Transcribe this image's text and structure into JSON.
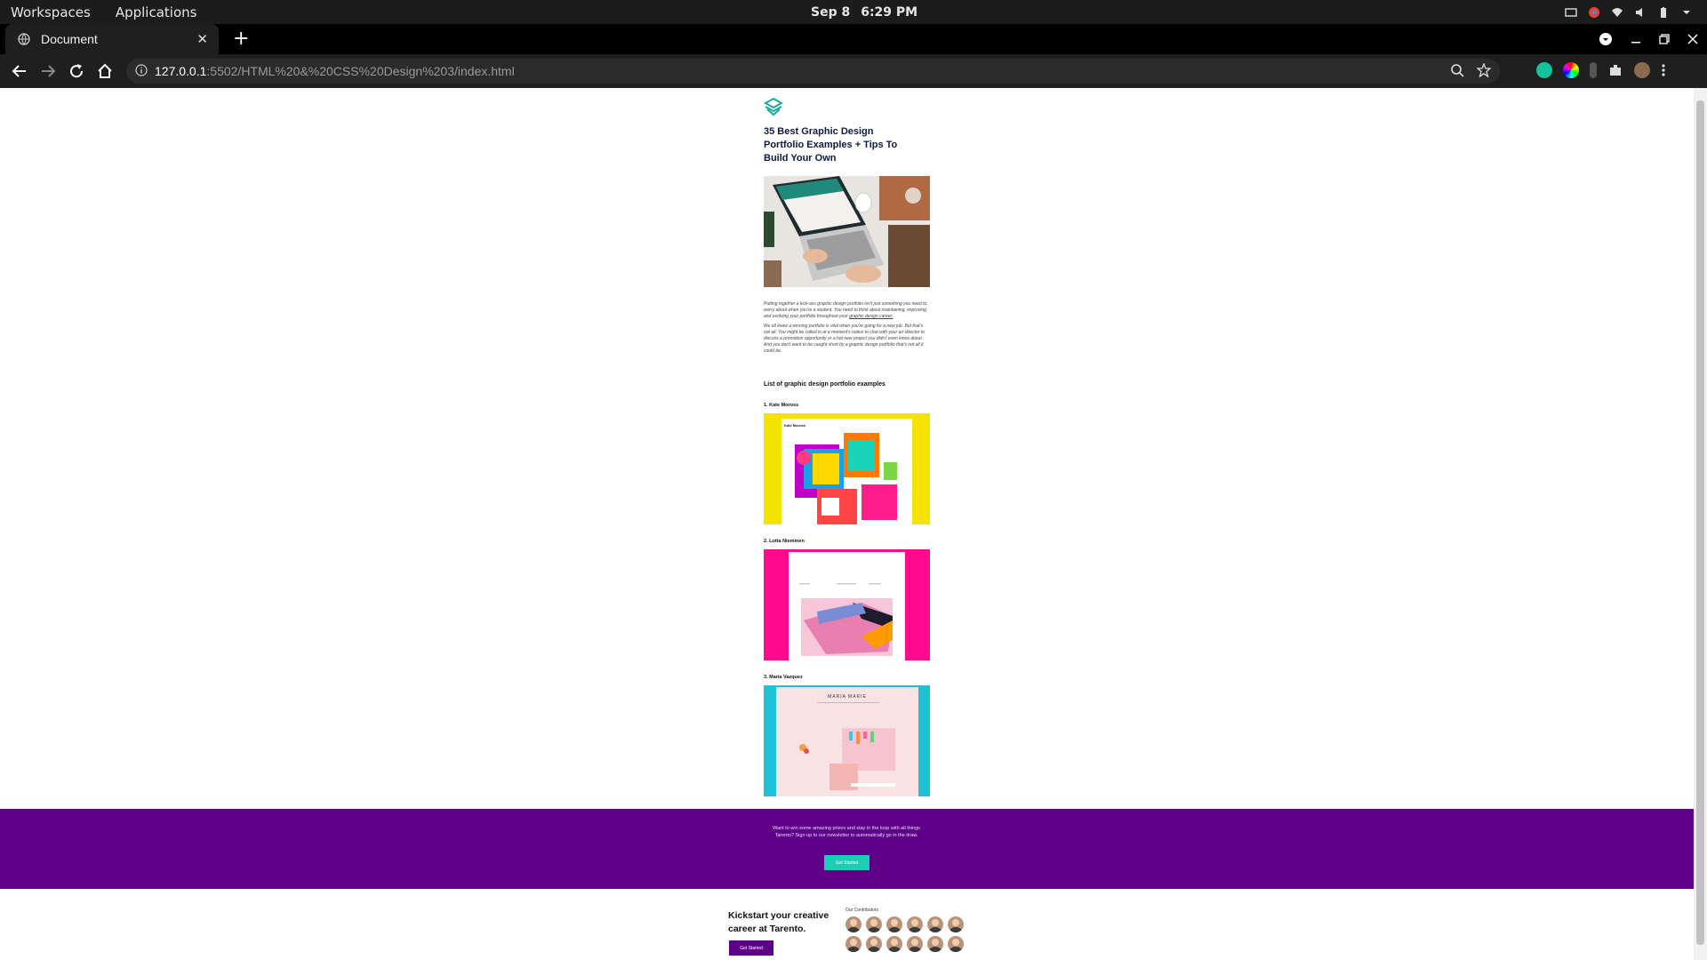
{
  "os": {
    "workspaces": "Workspaces",
    "applications": "Applications",
    "date": "Sep 8",
    "time": "6:29 PM"
  },
  "browser": {
    "tab_title": "Document",
    "url_host": "127.0.0.1",
    "url_path": ":5502/HTML%20&%20CSS%20Design%203/index.html"
  },
  "article": {
    "title": "35 Best Graphic Design Portfolio Examples + Tips To Build Your Own",
    "intro_p1": "Putting together a kick-ass graphic design portfolio isn't just something you need to worry about when you're a student. You need to think about maintaining, improving and evolving your portfolio throughout your",
    "intro_p1_link": "graphic design career.",
    "intro_p2": "We all know a winning portfolio is vital when you're going for a new job. But that's not all. You might be called in at a moment's notice to chat with your art director to discuss a promotion opportunity or a hot new project you didn't even know about. And you don't want to be caught short by a graphic design portfolio that's not all it could be.",
    "list_heading": "List of graphic design portfolio examples",
    "items": [
      {
        "label": "1. Kate Moross",
        "shot_caption": "Kate Moross"
      },
      {
        "label": "2. Lotta Nieminen"
      },
      {
        "label": "3. Maria Vazquez",
        "shot_caption": "MARIA MARIE"
      }
    ]
  },
  "newsletter": {
    "text": "Want to win some amazing prizes and stay in the loop with all things Tarento? Sign up to our newsletter to automatically go in the draw.",
    "button": "Get Started"
  },
  "footer": {
    "title": "Kickstart your creative career at Tarento.",
    "button": "Get Started",
    "contributors_label": "Our Contributors"
  },
  "colors": {
    "purple": "#5e0087",
    "teal": "#1ccfb4",
    "yellow": "#f4e200",
    "pink": "#ff0a8c",
    "cyan": "#1ec2d6"
  }
}
